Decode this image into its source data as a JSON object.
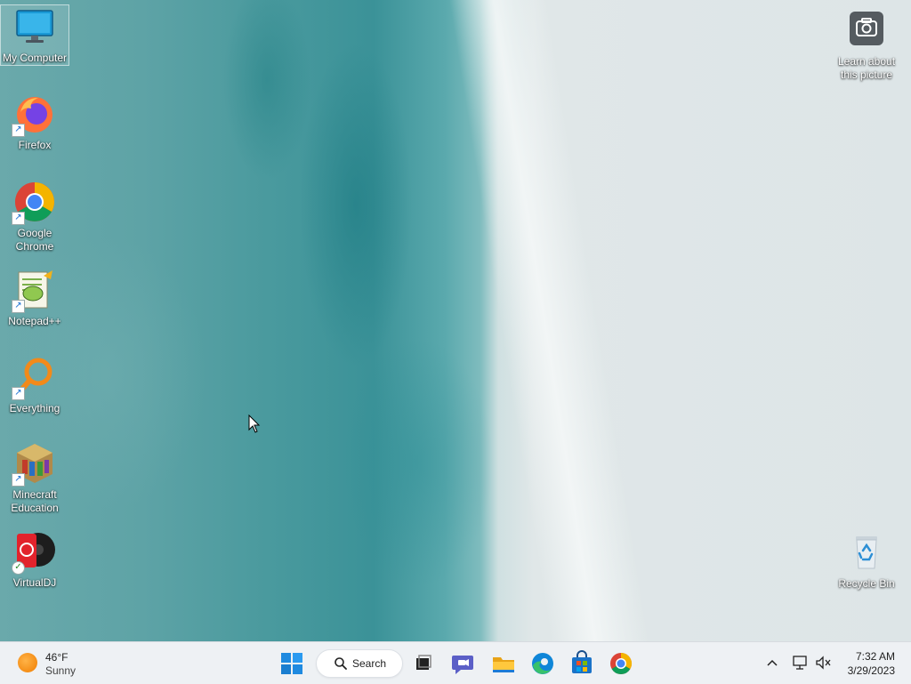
{
  "desktop": {
    "icons": [
      {
        "label": "My Computer",
        "icon": "monitor-icon"
      },
      {
        "label": "Firefox",
        "icon": "firefox-icon"
      },
      {
        "label": "Google Chrome",
        "icon": "chrome-icon"
      },
      {
        "label": "Notepad++",
        "icon": "notepadpp-icon"
      },
      {
        "label": "Everything",
        "icon": "everything-search-icon"
      },
      {
        "label": "Minecraft Education",
        "icon": "minecraft-education-icon"
      },
      {
        "label": "VirtualDJ",
        "icon": "virtualdj-icon"
      }
    ],
    "spotlight": {
      "label": "Learn about this picture",
      "icon": "camera-icon"
    },
    "recycle_bin": {
      "label": "Recycle Bin",
      "icon": "recycle-bin-icon"
    }
  },
  "taskbar": {
    "weather": {
      "temp": "46°F",
      "condition": "Sunny",
      "icon": "sun-icon"
    },
    "search_label": "Search",
    "apps": [
      "start-icon",
      "search-icon",
      "task-view-icon",
      "teams-chat-icon",
      "file-explorer-icon",
      "edge-icon",
      "store-icon",
      "chrome-icon"
    ],
    "tray": {
      "time": "7:32 AM",
      "date": "3/29/2023",
      "icons": [
        "chevron-up-icon",
        "network-icon",
        "volume-muted-icon"
      ]
    }
  },
  "colors": {
    "accent": "#0067c0",
    "taskbar_bg": "#eef1f4"
  }
}
